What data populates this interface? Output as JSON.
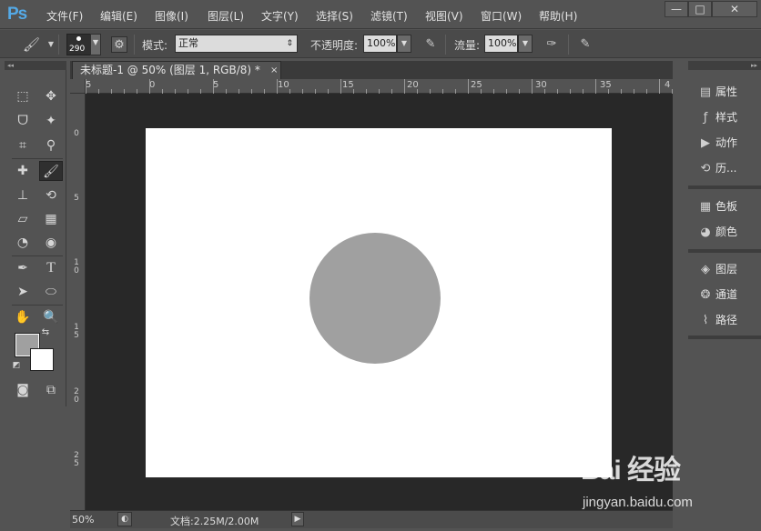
{
  "app": {
    "logo": "Ps"
  },
  "menu": {
    "items": [
      "文件(F)",
      "编辑(E)",
      "图像(I)",
      "图层(L)",
      "文字(Y)",
      "选择(S)",
      "滤镜(T)",
      "视图(V)",
      "窗口(W)",
      "帮助(H)"
    ]
  },
  "window_controls": {
    "minimize": "—",
    "restore": "□",
    "close": "✕"
  },
  "options": {
    "brush_size": "290",
    "mode_label": "模式:",
    "mode_value": "正常",
    "opacity_label": "不透明度:",
    "opacity_value": "100%",
    "flow_label": "流量:",
    "flow_value": "100%"
  },
  "document": {
    "tab_title": "未标题-1 @ 50% (图层 1, RGB/8) *",
    "close": "×",
    "zoom": "50%",
    "doc_info": "文档:2.25M/2.00M",
    "h_ruler_labels": [
      "5",
      "0",
      "5",
      "10",
      "15",
      "20",
      "25",
      "30",
      "35",
      "4"
    ],
    "v_ruler_labels": [
      "0",
      "5",
      "10",
      "15",
      "20",
      "25"
    ]
  },
  "panels": {
    "group1": [
      "属性",
      "样式",
      "动作",
      "历..."
    ],
    "group2": [
      "色板",
      "颜色"
    ],
    "group3": [
      "图层",
      "通道",
      "路径"
    ]
  },
  "colors": {
    "foreground": "#a0a0a0",
    "background": "#ffffff",
    "circle": "#a0a0a0"
  },
  "watermark": {
    "logo": "Bai 经验",
    "url": "jingyan.baidu.com"
  }
}
